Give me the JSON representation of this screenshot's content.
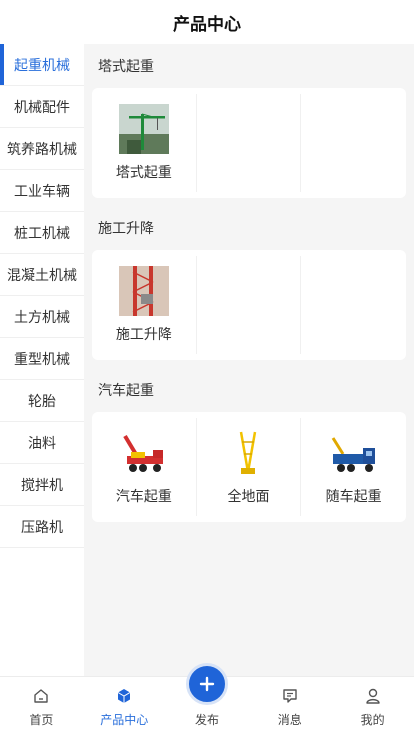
{
  "header": {
    "title": "产品中心"
  },
  "sidebar": {
    "items": [
      {
        "label": "起重机械"
      },
      {
        "label": "机械配件"
      },
      {
        "label": "筑养路机械"
      },
      {
        "label": "工业车辆"
      },
      {
        "label": "桩工机械"
      },
      {
        "label": "混凝土机械"
      },
      {
        "label": "土方机械"
      },
      {
        "label": "重型机械"
      },
      {
        "label": "轮胎"
      },
      {
        "label": "油料"
      },
      {
        "label": "搅拌机"
      },
      {
        "label": "压路机"
      }
    ]
  },
  "sections": [
    {
      "title": "塔式起重",
      "items": [
        {
          "label": "塔式起重",
          "image": "tower-crane-photo"
        }
      ]
    },
    {
      "title": "施工升降",
      "items": [
        {
          "label": "施工升降",
          "image": "construction-hoist-photo"
        }
      ]
    },
    {
      "title": "汽车起重",
      "items": [
        {
          "label": "汽车起重",
          "image": "truck-crane-photo"
        },
        {
          "label": "全地面",
          "image": "all-terrain-crane-photo"
        },
        {
          "label": "随车起重",
          "image": "truck-mounted-crane-photo"
        }
      ]
    }
  ],
  "tabbar": {
    "items": [
      {
        "label": "首页",
        "icon": "home-icon"
      },
      {
        "label": "产品中心",
        "icon": "cube-icon"
      },
      {
        "label": "发布",
        "icon": "plus-icon"
      },
      {
        "label": "消息",
        "icon": "message-icon"
      },
      {
        "label": "我的",
        "icon": "user-icon"
      }
    ]
  },
  "colors": {
    "accent": "#1f64d8",
    "background": "#f5f5f5"
  }
}
